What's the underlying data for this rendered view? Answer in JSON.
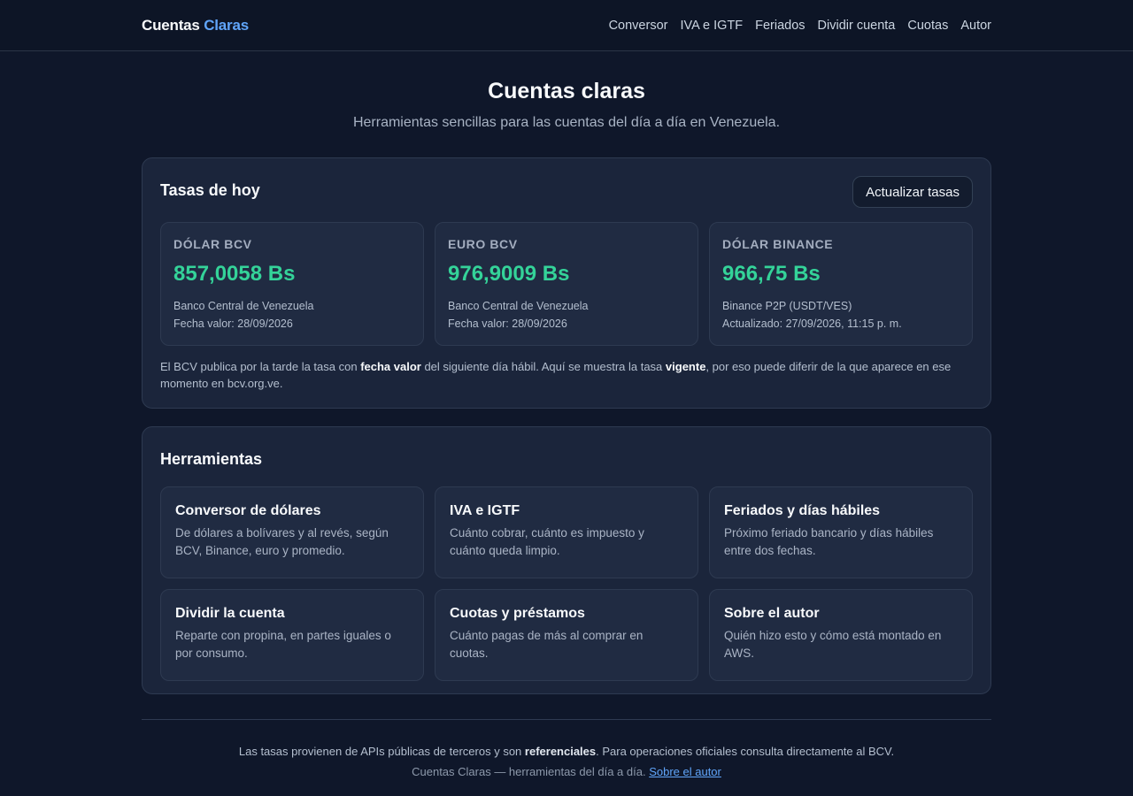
{
  "header": {
    "brand_main": "Cuentas",
    "brand_accent": "Claras",
    "nav": [
      {
        "label": "Conversor"
      },
      {
        "label": "IVA e IGTF"
      },
      {
        "label": "Feriados"
      },
      {
        "label": "Dividir cuenta"
      },
      {
        "label": "Cuotas"
      },
      {
        "label": "Autor"
      }
    ]
  },
  "hero": {
    "title": "Cuentas claras",
    "subtitle": "Herramientas sencillas para las cuentas del día a día en Venezuela."
  },
  "rates": {
    "title": "Tasas de hoy",
    "refresh_label": "Actualizar tasas",
    "cards": [
      {
        "label": "DÓLAR BCV",
        "value": "857,0058 Bs",
        "source": "Banco Central de Venezuela",
        "date": "Fecha valor: 28/09/2026"
      },
      {
        "label": "EURO BCV",
        "value": "976,9009 Bs",
        "source": "Banco Central de Venezuela",
        "date": "Fecha valor: 28/09/2026"
      },
      {
        "label": "DÓLAR BINANCE",
        "value": "966,75 Bs",
        "source": "Binance P2P (USDT/VES)",
        "date": "Actualizado: 27/09/2026, 11:15 p. m."
      }
    ],
    "note": {
      "part1": "El BCV publica por la tarde la tasa con ",
      "bold1": "fecha valor",
      "part2": " del siguiente día hábil. Aquí se muestra la tasa ",
      "bold2": "vigente",
      "part3": ", por eso puede diferir de la que aparece en ese momento en bcv.org.ve."
    }
  },
  "tools": {
    "title": "Herramientas",
    "items": [
      {
        "title": "Conversor de dólares",
        "desc": "De dólares a bolívares y al revés, según BCV, Binance, euro y promedio."
      },
      {
        "title": "IVA e IGTF",
        "desc": "Cuánto cobrar, cuánto es impuesto y cuánto queda limpio."
      },
      {
        "title": "Feriados y días hábiles",
        "desc": "Próximo feriado bancario y días hábiles entre dos fechas."
      },
      {
        "title": "Dividir la cuenta",
        "desc": "Reparte con propina, en partes iguales o por consumo."
      },
      {
        "title": "Cuotas y préstamos",
        "desc": "Cuánto pagas de más al comprar en cuotas."
      },
      {
        "title": "Sobre el autor",
        "desc": "Quién hizo esto y cómo está montado en AWS."
      }
    ]
  },
  "footer": {
    "line1_part1": "Las tasas provienen de APIs públicas de terceros y son ",
    "line1_bold": "referenciales",
    "line1_part2": ". Para operaciones oficiales consulta directamente al BCV.",
    "line2_text": "Cuentas Claras — herramientas del día a día. ",
    "line2_link": "Sobre el autor"
  },
  "colors": {
    "background": "#0f172a",
    "panel": "#1b253b",
    "accent_blue": "#60a5fa",
    "accent_green": "#34d399"
  }
}
